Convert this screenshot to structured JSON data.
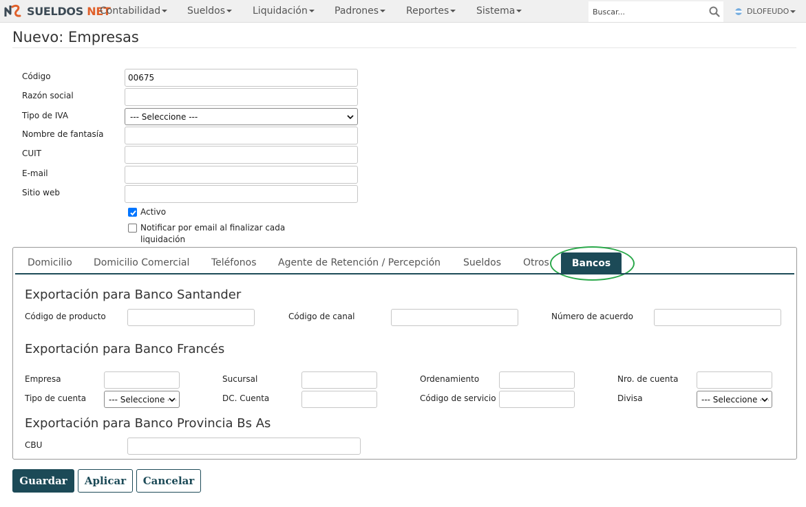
{
  "navbar": {
    "logo": {
      "part1": "SUELDOS",
      "part2": "NET"
    },
    "menu": [
      {
        "label": "Contabilidad"
      },
      {
        "label": "Sueldos"
      },
      {
        "label": "Liquidación"
      },
      {
        "label": "Padrones"
      },
      {
        "label": "Reportes"
      },
      {
        "label": "Sistema"
      }
    ],
    "search": {
      "placeholder": "Buscar..."
    },
    "user": "DLOFEUDO"
  },
  "page": {
    "title": "Nuevo: Empresas"
  },
  "form": {
    "codigo": {
      "label": "Código",
      "value": "00675"
    },
    "razon_social": {
      "label": "Razón social",
      "value": ""
    },
    "tipo_iva": {
      "label": "Tipo de IVA",
      "value": "--- Seleccione ---"
    },
    "nombre_fantasia": {
      "label": "Nombre de fantasía",
      "value": ""
    },
    "cuit": {
      "label": "CUIT",
      "value": ""
    },
    "email": {
      "label": "E-mail",
      "value": ""
    },
    "sitio_web": {
      "label": "Sitio web",
      "value": ""
    },
    "activo": {
      "label": "Activo",
      "checked": true
    },
    "notificar": {
      "label_line1": "Notificar por email al finalizar cada",
      "label_line2": "liquidación",
      "checked": false
    }
  },
  "tabs": [
    {
      "label": "Domicilio"
    },
    {
      "label": "Domicilio Comercial"
    },
    {
      "label": "Teléfonos"
    },
    {
      "label": "Agente de Retención / Percepción"
    },
    {
      "label": "Sueldos"
    },
    {
      "label": "Otros"
    },
    {
      "label": "Bancos",
      "active": true
    }
  ],
  "bancos": {
    "santander": {
      "title": "Exportación para Banco Santander",
      "codigo_producto": {
        "label": "Código de producto",
        "value": ""
      },
      "codigo_canal": {
        "label": "Código de canal",
        "value": ""
      },
      "numero_acuerdo": {
        "label": "Número de acuerdo",
        "value": ""
      }
    },
    "frances": {
      "title": "Exportación para Banco Francés",
      "empresa": {
        "label": "Empresa",
        "value": ""
      },
      "sucursal": {
        "label": "Sucursal",
        "value": ""
      },
      "ordenamiento": {
        "label": "Ordenamiento",
        "value": ""
      },
      "nro_cuenta": {
        "label": "Nro. de cuenta",
        "value": ""
      },
      "tipo_cuenta": {
        "label": "Tipo de cuenta",
        "value": "--- Seleccione ---"
      },
      "dc_cuenta": {
        "label": "DC. Cuenta",
        "value": ""
      },
      "codigo_servicio": {
        "label": "Código de servicio",
        "value": ""
      },
      "divisa": {
        "label": "Divisa",
        "value": "--- Seleccione ---"
      }
    },
    "provincia": {
      "title": "Exportación para Banco Provincia Bs As",
      "cbu": {
        "label": "CBU",
        "value": ""
      }
    }
  },
  "buttons": {
    "save": "Guardar",
    "apply": "Aplicar",
    "cancel": "Cancelar"
  },
  "colors": {
    "primary": "#1c4a57",
    "brand_orange": "#e0602a",
    "highlight": "#2aa84a"
  }
}
